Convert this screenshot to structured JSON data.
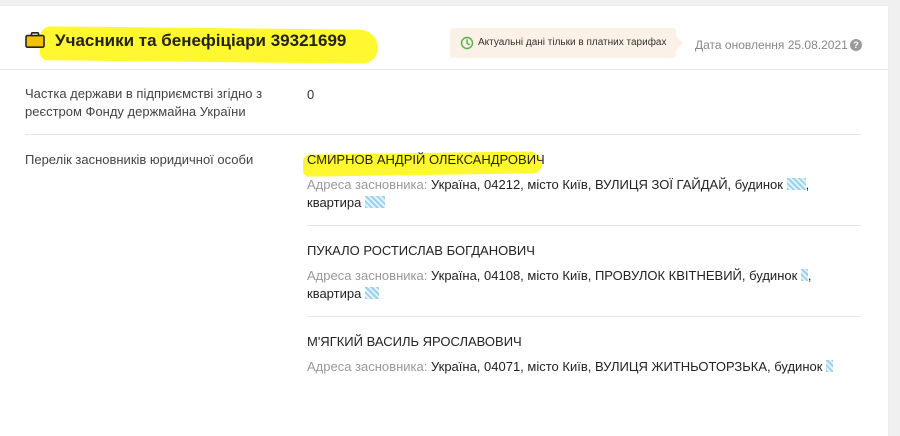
{
  "header": {
    "title": "Учасники та бенефіціари 39321699",
    "badge_text": "Актуальні дані тільки в платних тарифах",
    "update_text": "Дата оновлення 25.08.2021",
    "help_symbol": "?",
    "icons": [
      "briefcase-icon",
      "clock-icon",
      "help-icon"
    ],
    "accent_color": "#f2c200",
    "highlight_color": "#fff831"
  },
  "state_share": {
    "label": "Частка держави в підприємстві згідно з реєстром Фонду держмайна України",
    "value": "0"
  },
  "founders": {
    "label": "Перелік засновників юридичної особи",
    "address_prefix": "Адреса засновника:",
    "items": [
      {
        "name": "СМИРНОВ АНДРІЙ ОЛЕКСАНДРОВИЧ",
        "address_line1": "Україна, 04212, місто Київ, ВУЛИЦЯ ЗОЇ ГАЙДАЙ, будинок",
        "address_line2": ", квартира"
      },
      {
        "name": "ПУКАЛО РОСТИСЛАВ БОГДАНОВИЧ",
        "address_line1": "Україна, 04108, місто Київ, ПРОВУЛОК КВІТНЕВИЙ, будинок",
        "address_line2": ", квартира"
      },
      {
        "name": "М'ЯГКИЙ ВАСИЛЬ ЯРОСЛАВОВИЧ",
        "address_line1": "Україна, 04071, місто Київ, ВУЛИЦЯ ЖИТНЬОТОРЗЬКА, будинок"
      }
    ]
  }
}
